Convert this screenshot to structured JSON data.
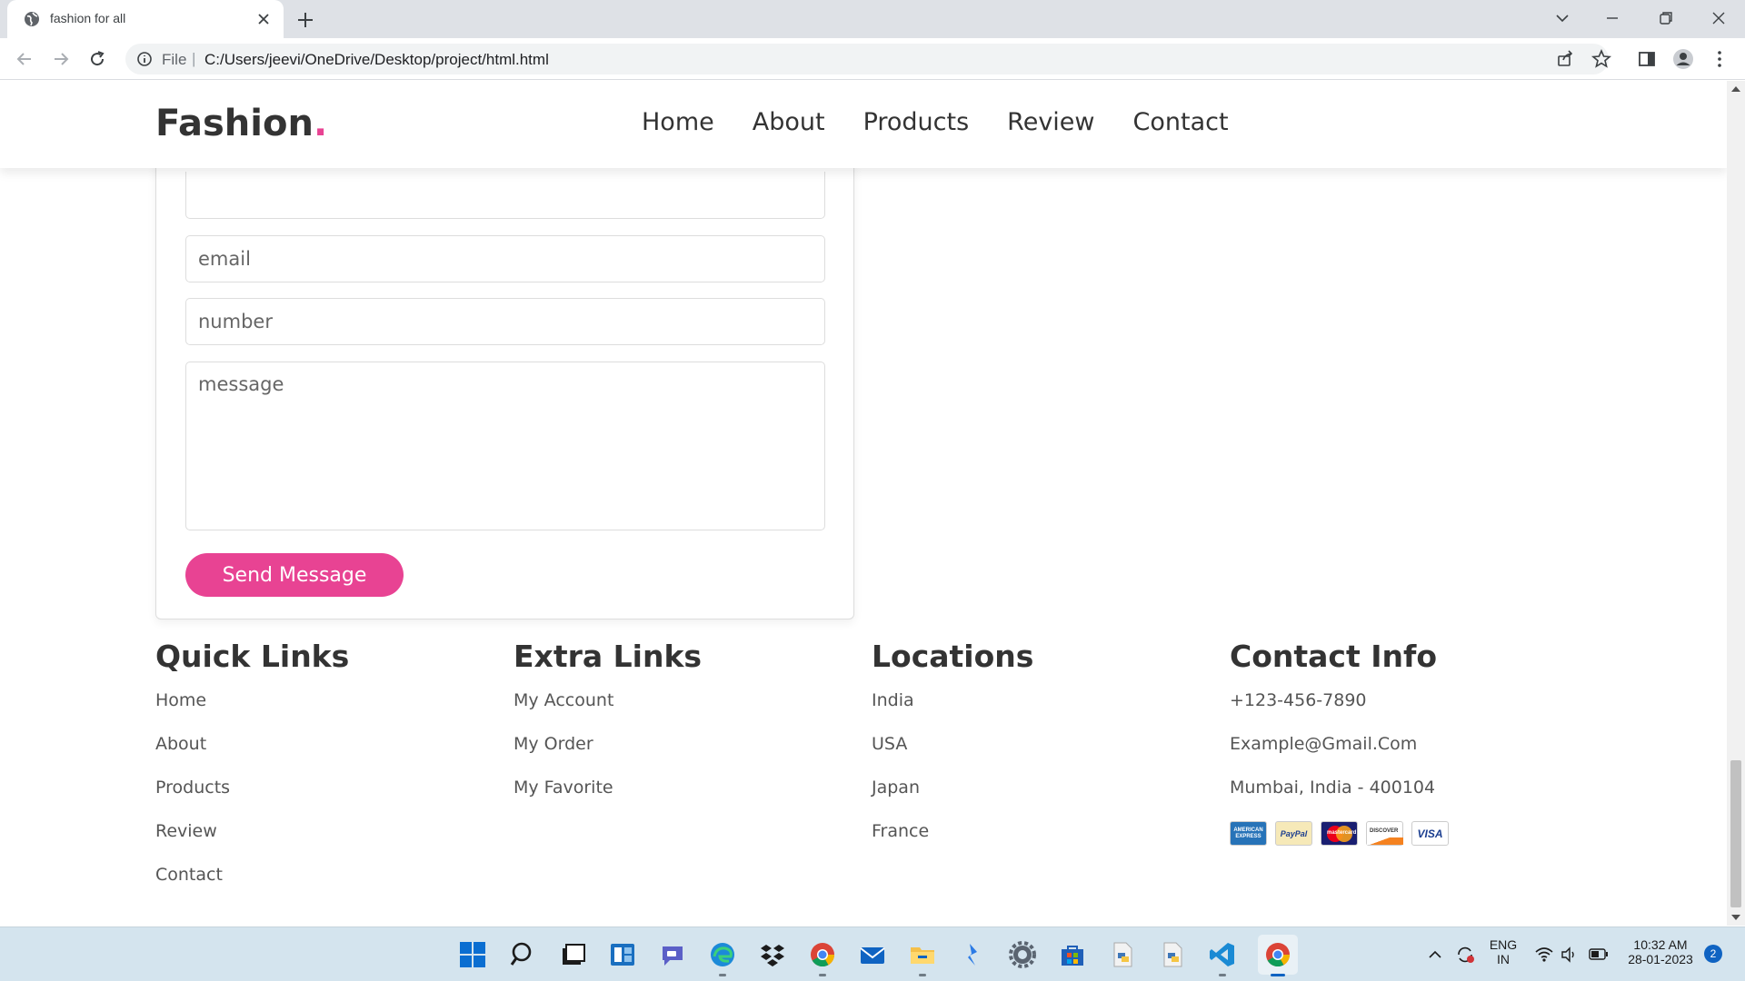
{
  "browser": {
    "tab_title": "fashion for all",
    "scheme_label": "File",
    "separator": "|",
    "url": "C:/Users/jeevi/OneDrive/Desktop/project/html.html"
  },
  "site": {
    "logo_text": "Fashion",
    "logo_dot": ".",
    "nav": [
      "Home",
      "About",
      "Products",
      "Review",
      "Contact"
    ],
    "accent_color": "#e84393"
  },
  "form": {
    "email_placeholder": "email",
    "number_placeholder": "number",
    "message_placeholder": "message",
    "submit_label": "Send Message"
  },
  "footer": {
    "quick_links": {
      "title": "Quick Links",
      "items": [
        "Home",
        "About",
        "Products",
        "Review",
        "Contact"
      ]
    },
    "extra_links": {
      "title": "Extra Links",
      "items": [
        "My Account",
        "My Order",
        "My Favorite"
      ]
    },
    "locations": {
      "title": "Locations",
      "items": [
        "India",
        "USA",
        "Japan",
        "France"
      ]
    },
    "contact_info": {
      "title": "Contact Info",
      "items": [
        "+123-456-7890",
        "Example@Gmail.Com",
        "Mumbai, India - 400104"
      ]
    },
    "payment_cards": [
      "AMERICAN EXPRESS",
      "PayPal",
      "mastercard",
      "DISCOVER",
      "VISA"
    ]
  },
  "taskbar": {
    "lang_top": "ENG",
    "lang_bottom": "IN",
    "time": "10:32 AM",
    "date": "28-01-2023",
    "notification_count": "2"
  }
}
